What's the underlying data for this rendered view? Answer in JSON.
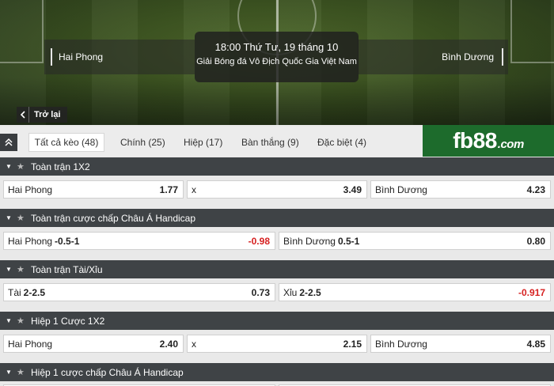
{
  "match": {
    "home": "Hai Phong",
    "away": "Bình Dương",
    "time": "18:00 Thứ Tư, 19 tháng 10",
    "league": "Giải Bóng đá Vô Địch Quốc Gia Việt Nam",
    "back_label": "Trở lại"
  },
  "tabs": [
    {
      "label": "Tất cả kèo (48)",
      "active": true
    },
    {
      "label": "Chính (25)"
    },
    {
      "label": "Hiệp (17)"
    },
    {
      "label": "Bàn thắng (9)"
    },
    {
      "label": "Đặc biệt (4)"
    }
  ],
  "brand": {
    "logo_main": "fb88",
    "logo_suffix": ".com",
    "color": "#1d6b2c"
  },
  "colors": {
    "negative": "#d62020",
    "header": "#3f4346"
  },
  "markets": [
    {
      "title": "Toàn trận 1X2",
      "odds": [
        {
          "name": "Hai Phong",
          "hcp": "",
          "price": "1.77"
        },
        {
          "name": "x",
          "hcp": "",
          "price": "3.49"
        },
        {
          "name": "Bình Dương",
          "hcp": "",
          "price": "4.23"
        }
      ]
    },
    {
      "title": "Toàn trận cược chấp Châu Á Handicap",
      "odds": [
        {
          "name": "Hai Phong",
          "hcp": "-0.5-1",
          "price": "-0.98",
          "negative": true
        },
        {
          "name": "Bình Dương",
          "hcp": "0.5-1",
          "price": "0.80"
        }
      ]
    },
    {
      "title": "Toàn trận Tài/Xỉu",
      "odds": [
        {
          "name": "Tài",
          "hcp": "2-2.5",
          "price": "0.73"
        },
        {
          "name": "Xỉu",
          "hcp": "2-2.5",
          "price": "-0.917",
          "negative": true
        }
      ]
    },
    {
      "title": "Hiệp 1 Cược 1X2",
      "odds": [
        {
          "name": "Hai Phong",
          "hcp": "",
          "price": "2.40"
        },
        {
          "name": "x",
          "hcp": "",
          "price": "2.15"
        },
        {
          "name": "Bình Dương",
          "hcp": "",
          "price": "4.85"
        }
      ]
    },
    {
      "title": "Hiệp 1 cược chấp Châu Á Handicap",
      "odds": []
    }
  ]
}
